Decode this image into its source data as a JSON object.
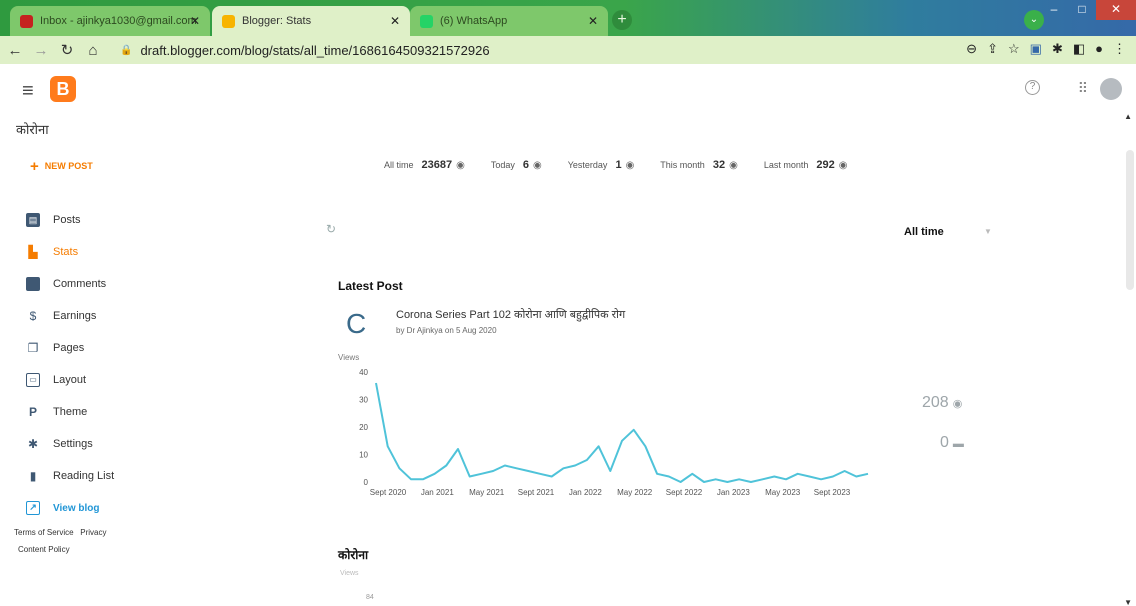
{
  "browser": {
    "tabs": [
      {
        "title": "Inbox - ajinkya1030@gmail.com",
        "favicon_color": "#c5221f"
      },
      {
        "title": "Blogger: Stats",
        "favicon_color": "#f7b400"
      },
      {
        "title": "(6) WhatsApp",
        "favicon_color": "#25d366"
      }
    ],
    "url": "draft.blogger.com/blog/stats/all_time/1686164509321572926"
  },
  "header": {
    "blog_name": "कोरोना"
  },
  "sidebar": {
    "new_post": "NEW POST",
    "items": [
      {
        "label": "Posts",
        "icon": "posts-icon"
      },
      {
        "label": "Stats",
        "icon": "stats-icon"
      },
      {
        "label": "Comments",
        "icon": "comments-icon"
      },
      {
        "label": "Earnings",
        "icon": "earnings-icon"
      },
      {
        "label": "Pages",
        "icon": "pages-icon"
      },
      {
        "label": "Layout",
        "icon": "layout-icon"
      },
      {
        "label": "Theme",
        "icon": "theme-icon"
      },
      {
        "label": "Settings",
        "icon": "settings-icon"
      },
      {
        "label": "Reading List",
        "icon": "reading-list-icon"
      },
      {
        "label": "View blog",
        "icon": "view-blog-icon"
      }
    ],
    "terms": "Terms of Service",
    "privacy": "Privacy",
    "content_policy": "Content Policy"
  },
  "summary": [
    {
      "label": "All time",
      "value": "23687"
    },
    {
      "label": "Today",
      "value": "6"
    },
    {
      "label": "Yesterday",
      "value": "1"
    },
    {
      "label": "This month",
      "value": "32"
    },
    {
      "label": "Last month",
      "value": "292"
    }
  ],
  "range": "All time",
  "latest": {
    "section_title": "Latest Post",
    "icon_letter": "C",
    "post_title": "Corona Series Part 102   कोरोना आणि बहुद्वीपिक रोग",
    "post_meta": "by Dr Ajinkya on 5 Aug 2020",
    "views": "208",
    "comments": "0"
  },
  "section2": {
    "title": "कोरोना",
    "views_label": "Views",
    "tick": "84"
  },
  "chart_data": {
    "type": "line",
    "ylabel": "Views",
    "ylim": [
      0,
      40
    ],
    "yticks": [
      "40",
      "30",
      "20",
      "10",
      "0"
    ],
    "xticks": [
      "Sept 2020",
      "Jan 2021",
      "May 2021",
      "Sept 2021",
      "Jan 2022",
      "May 2022",
      "Sept 2022",
      "Jan 2023",
      "May 2023",
      "Sept 2023"
    ],
    "color": "#4fc3d9",
    "series": [
      {
        "values": [
          36,
          13,
          5,
          1,
          1,
          3,
          6,
          12,
          2,
          3,
          4,
          6,
          5,
          4,
          3,
          2,
          5,
          6,
          8,
          13,
          4,
          15,
          19,
          13,
          3,
          2,
          0,
          3,
          0,
          1,
          0,
          1,
          0,
          1,
          2,
          1,
          3,
          2,
          1,
          2,
          4,
          2,
          3
        ]
      }
    ]
  }
}
